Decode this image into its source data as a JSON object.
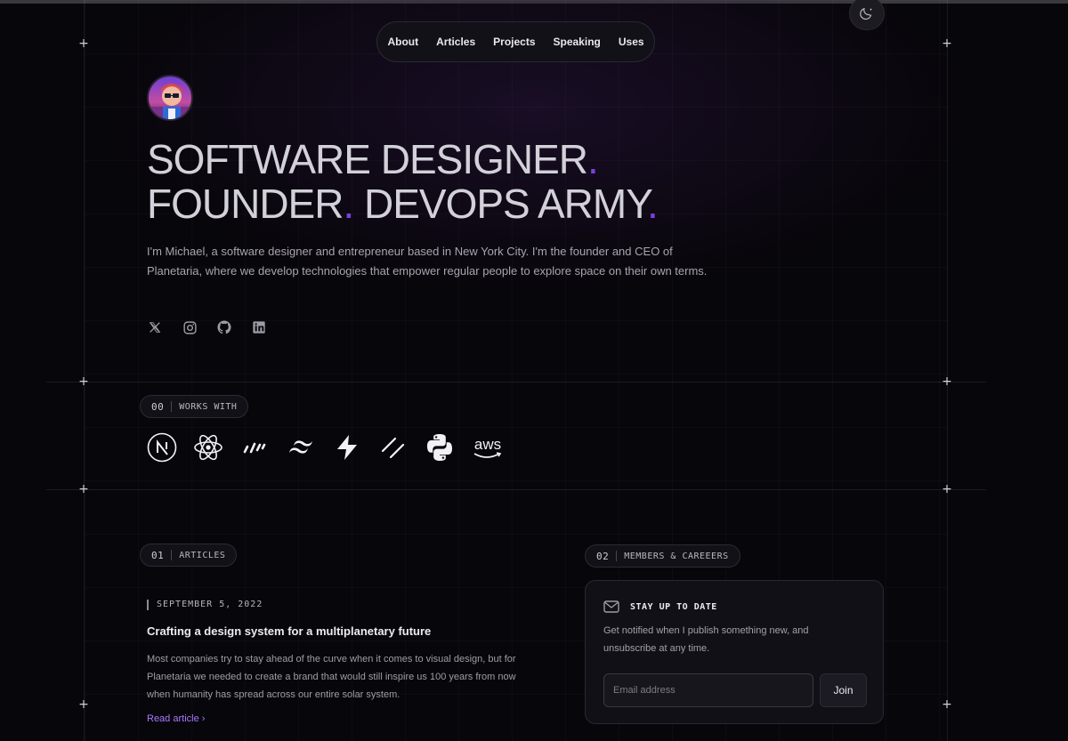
{
  "nav": {
    "items": [
      "About",
      "Articles",
      "Projects",
      "Speaking",
      "Uses"
    ]
  },
  "hero": {
    "line1": "SOFTWARE DESIGNER",
    "line2a": "FOUNDER",
    "line2b": "DEVOPS ARMY",
    "dot": ".",
    "bio": "I'm Michael, a software designer and entrepreneur based in New York City. I'm the founder and CEO of Planetaria, where we develop technologies that empower regular people to explore space on their own terms.",
    "socials": [
      "x-icon",
      "instagram-icon",
      "github-icon",
      "linkedin-icon"
    ]
  },
  "works_with": {
    "num": "00",
    "label": "WORKS WITH",
    "tech": [
      "nextjs-icon",
      "react-icon",
      "vite-icon",
      "tailwind-icon",
      "supabase-icon",
      "shadcn-icon",
      "python-icon",
      "aws-icon"
    ],
    "aws_text": "aws"
  },
  "articles": {
    "num": "01",
    "label": "ARTICLES",
    "items": [
      {
        "date": "SEPTEMBER 5, 2022",
        "title": "Crafting a design system for a multiplanetary future",
        "summary": "Most companies try to stay ahead of the curve when it comes to visual design, but for Planetaria we needed to create a brand that would still inspire us 100 years from now when humanity has spread across our entire solar system.",
        "link": "Read article"
      }
    ]
  },
  "members": {
    "num": "02",
    "label": "MEMBERS & CAREEERS",
    "card_title": "STAY UP TO DATE",
    "card_text": "Get notified when I publish something new, and unsubscribe at any time.",
    "email_placeholder": "Email address",
    "join": "Join"
  },
  "colors": {
    "accent": "#7b3fe0",
    "link": "#a978ff",
    "background": "#07060a"
  }
}
